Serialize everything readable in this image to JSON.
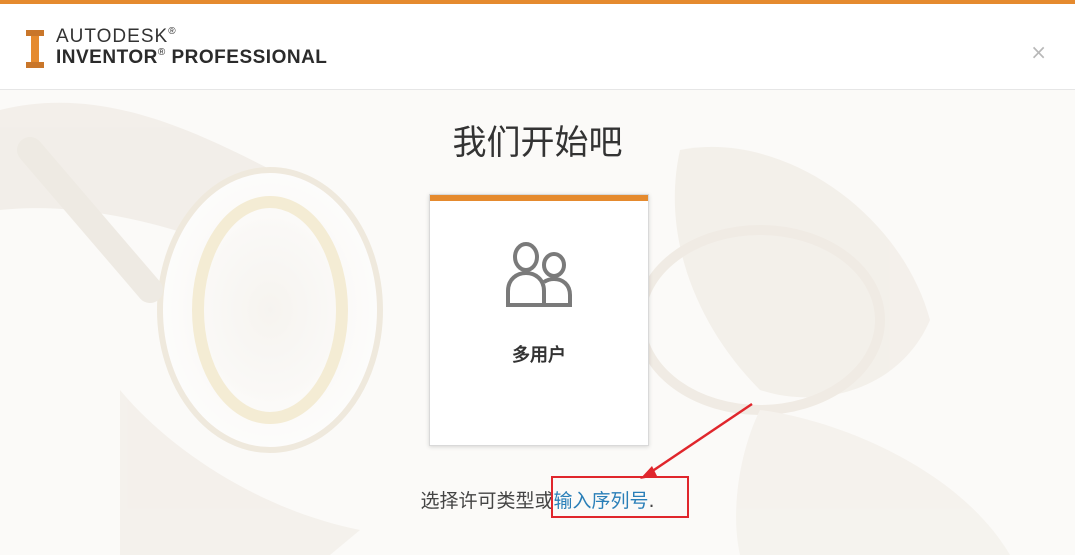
{
  "header": {
    "brand_line1": "AUTODESK",
    "brand_line2": "INVENTOR",
    "brand_line2_rest": "PROFESSIONAL",
    "registered": "®",
    "close_label": "×"
  },
  "main": {
    "title": "我们开始吧",
    "card": {
      "label": "多用户",
      "icon": "users-icon"
    },
    "footer_text": "选择许可类型或",
    "serial_link": "输入序列号",
    "footer_end": "."
  },
  "colors": {
    "accent": "#e58a2e",
    "link": "#2a7fb8",
    "annotation": "#e0262c"
  }
}
